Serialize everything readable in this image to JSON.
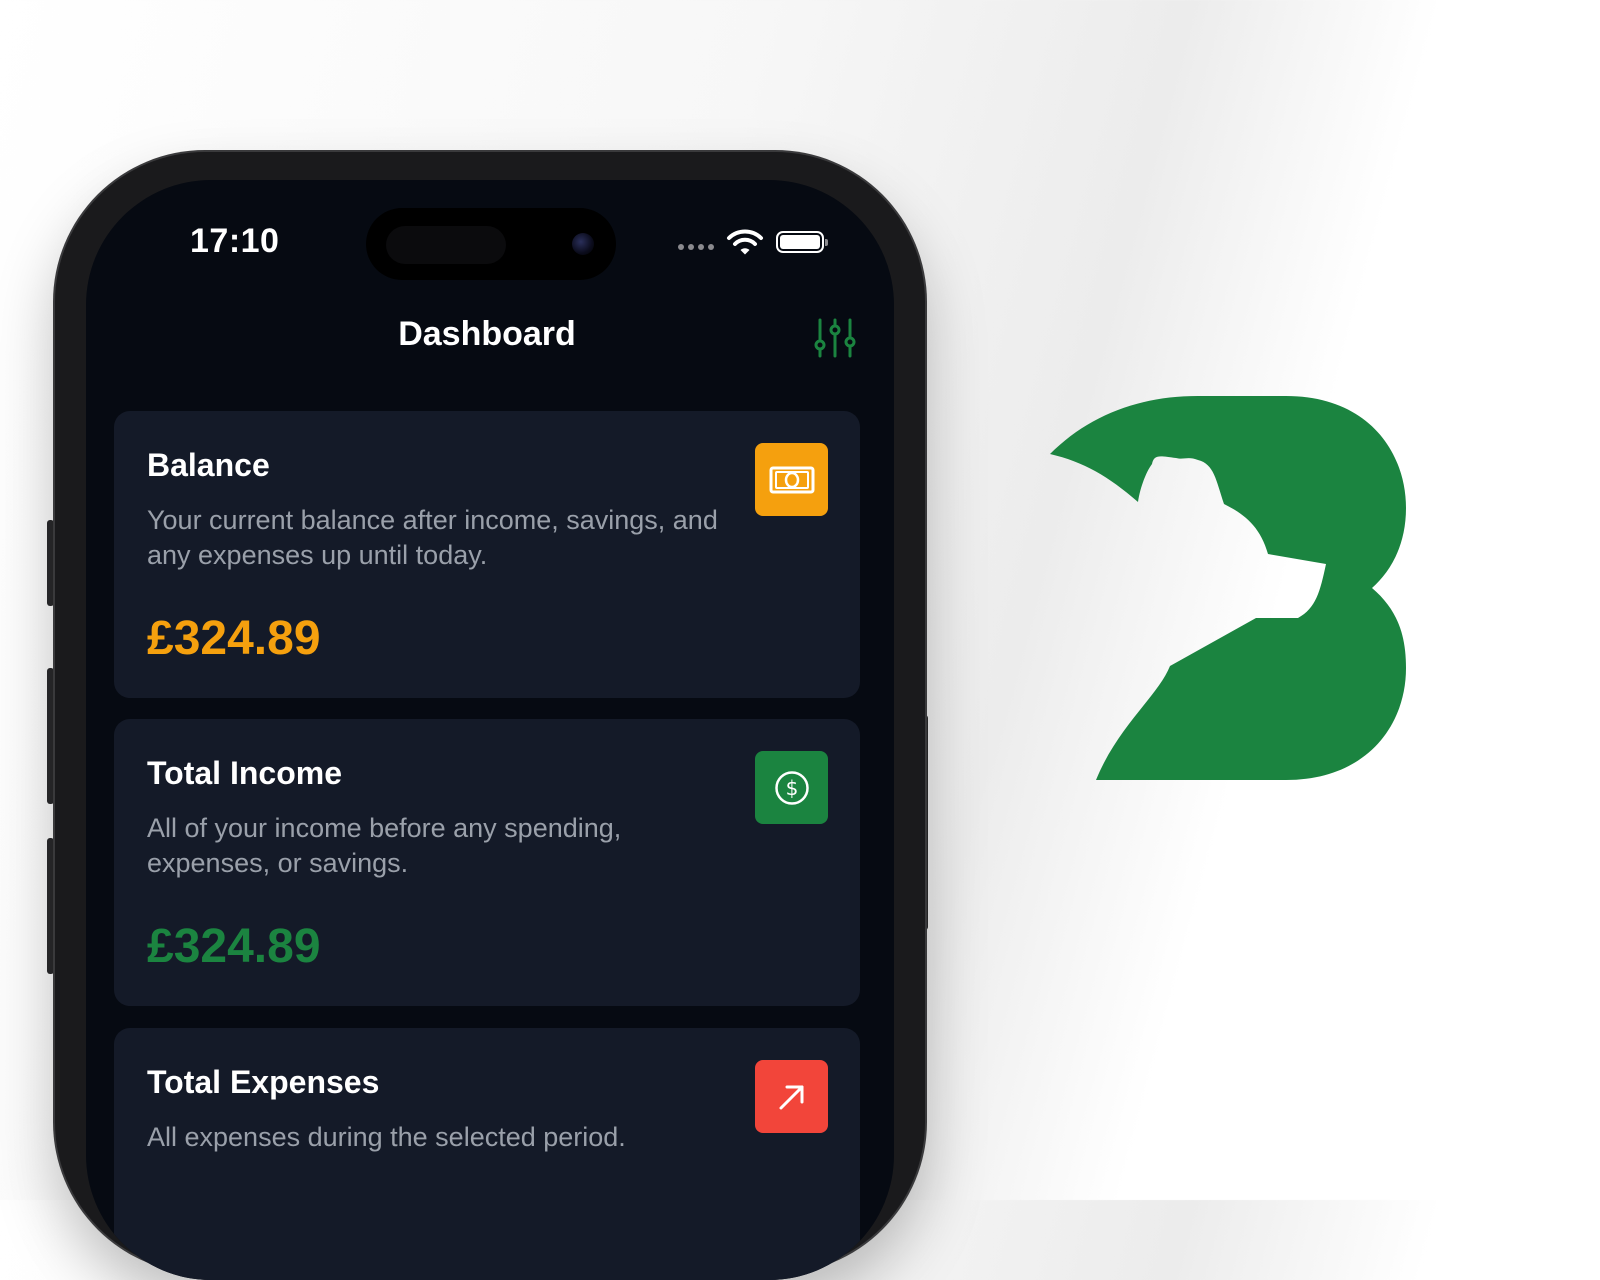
{
  "status_bar": {
    "time": "17:10"
  },
  "header": {
    "title": "Dashboard",
    "filter_icon": "sliders-icon"
  },
  "colors": {
    "accent_green": "#1b8440",
    "balance_orange": "#f5a00e",
    "expense_red": "#f2453a",
    "card_bg": "#141a28",
    "screen_bg": "#060a12"
  },
  "cards": [
    {
      "title": "Balance",
      "description": "Your current balance after income, savings, and any expenses up until today.",
      "value": "£324.89",
      "icon": "banknote-icon"
    },
    {
      "title": "Total Income",
      "description": "All of your income before any spending, expenses, or savings.",
      "value": "£324.89",
      "icon": "dollar-circle-icon"
    },
    {
      "title": "Total Expenses",
      "description": "All expenses during the selected period.",
      "icon": "arrow-up-right-icon"
    }
  ],
  "brand": {
    "logo": "brand-logo-b-bear"
  }
}
